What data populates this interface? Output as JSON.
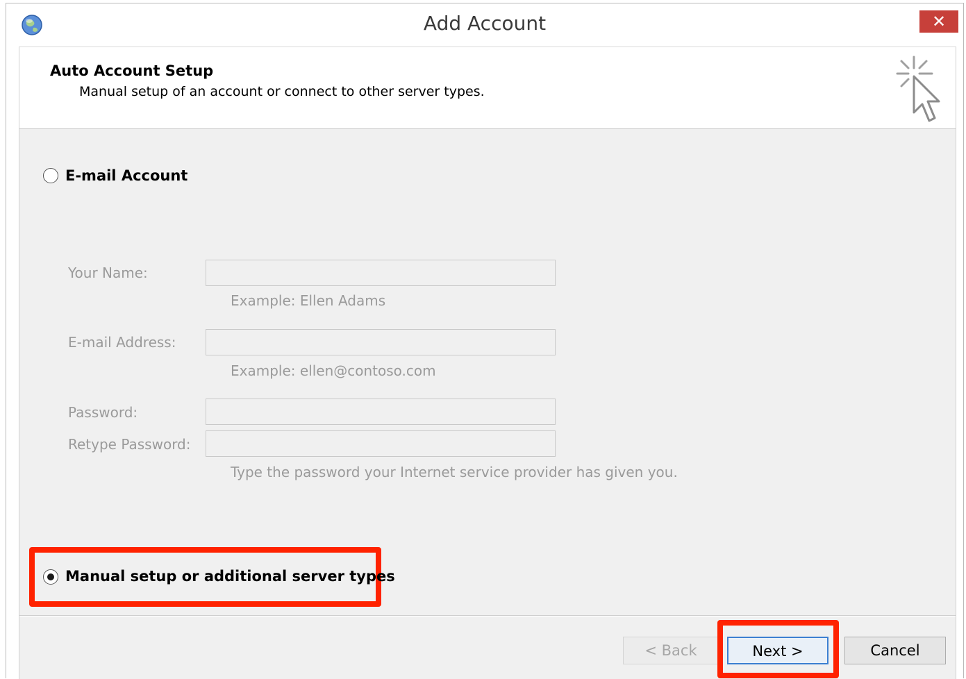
{
  "window": {
    "title": "Add Account",
    "close_glyph": "✕"
  },
  "header": {
    "title": "Auto Account Setup",
    "subtitle": "Manual setup of an account or connect to other server types."
  },
  "options": {
    "email_account_label": "E-mail Account",
    "email_account_selected": false,
    "manual_setup_label": "Manual setup or additional server types",
    "manual_setup_selected": true
  },
  "form": {
    "your_name": {
      "label": "Your Name:",
      "value": "",
      "hint": "Example: Ellen Adams"
    },
    "email_address": {
      "label": "E-mail Address:",
      "value": "",
      "hint": "Example: ellen@contoso.com"
    },
    "password": {
      "label": "Password:",
      "value": ""
    },
    "retype_password": {
      "label": "Retype Password:",
      "value": "",
      "hint": "Type the password your Internet service provider has given you."
    }
  },
  "buttons": {
    "back": "< Back",
    "next": "Next >",
    "cancel": "Cancel"
  },
  "icons": {
    "app": "outlook-globe-icon",
    "header": "sparkle-cursor-icon",
    "close": "close-icon"
  },
  "colors": {
    "highlight": "#ff2200",
    "close_button": "#c7403a",
    "next_border": "#3c7fd1"
  }
}
